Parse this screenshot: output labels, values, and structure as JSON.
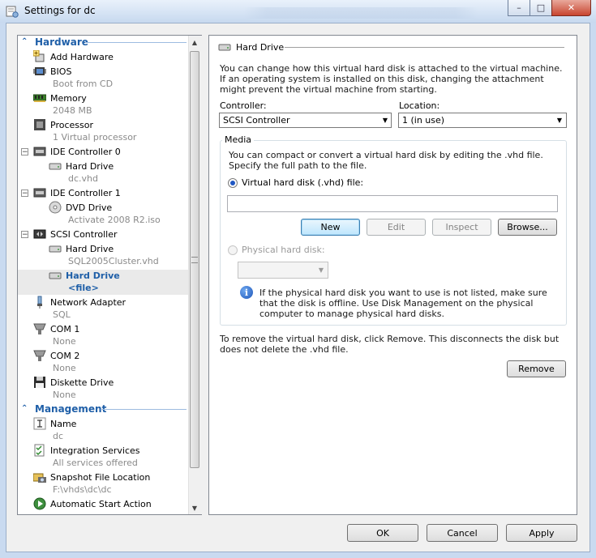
{
  "window": {
    "title": "Settings for dc",
    "controls": {
      "minimize": "–",
      "maximize": "□",
      "close": "✕"
    }
  },
  "tree": {
    "hardware_header": "Hardware",
    "management_header": "Management",
    "items": [
      {
        "label": "Add Hardware",
        "sub": ""
      },
      {
        "label": "BIOS",
        "sub": "Boot from CD"
      },
      {
        "label": "Memory",
        "sub": "2048 MB"
      },
      {
        "label": "Processor",
        "sub": "1 Virtual processor"
      },
      {
        "label": "IDE Controller 0",
        "sub": ""
      },
      {
        "label": "Hard Drive",
        "sub": "dc.vhd"
      },
      {
        "label": "IDE Controller 1",
        "sub": ""
      },
      {
        "label": "DVD Drive",
        "sub": "Activate 2008 R2.iso"
      },
      {
        "label": "SCSI Controller",
        "sub": ""
      },
      {
        "label": "Hard Drive",
        "sub": "SQL2005Cluster.vhd"
      },
      {
        "label": "Hard Drive",
        "sub": "<file>"
      },
      {
        "label": "Network Adapter",
        "sub": "SQL"
      },
      {
        "label": "COM 1",
        "sub": "None"
      },
      {
        "label": "COM 2",
        "sub": "None"
      },
      {
        "label": "Diskette Drive",
        "sub": "None"
      }
    ],
    "mgmt_items": [
      {
        "label": "Name",
        "sub": "dc"
      },
      {
        "label": "Integration Services",
        "sub": "All services offered"
      },
      {
        "label": "Snapshot File Location",
        "sub": "F:\\vhds\\dc\\dc"
      },
      {
        "label": "Automatic Start Action",
        "sub": ""
      }
    ],
    "expanders": [
      "−",
      "−",
      "−"
    ]
  },
  "detail": {
    "section_title": "Hard Drive",
    "intro": "You can change how this virtual hard disk is attached to the virtual machine. If an operating system is installed on this disk, changing the attachment might prevent the virtual machine from starting.",
    "controller_label": "Controller:",
    "controller_value": "SCSI Controller",
    "location_label": "Location:",
    "location_value": "1 (in use)",
    "media_legend": "Media",
    "media_text": "You can compact or convert a virtual hard disk by editing the .vhd file. Specify the full path to the file.",
    "vhd_radio_label": "Virtual hard disk (.vhd) file:",
    "vhd_path": "",
    "buttons": {
      "new": "New",
      "edit": "Edit",
      "inspect": "Inspect",
      "browse": "Browse..."
    },
    "physical_radio_label": "Physical hard disk:",
    "physical_value": "",
    "info_text": "If the physical hard disk you want to use is not listed, make sure that the disk is offline. Use Disk Management on the physical computer to manage physical hard disks.",
    "remove_text": "To remove the virtual hard disk, click Remove. This disconnects the disk but does not delete the .vhd file.",
    "remove_button": "Remove"
  },
  "footer": {
    "ok": "OK",
    "cancel": "Cancel",
    "apply": "Apply"
  },
  "colors": {
    "accent": "#1f5fa8",
    "selection_text": "#1f5fa8",
    "window_frame": "#c9daf0"
  }
}
